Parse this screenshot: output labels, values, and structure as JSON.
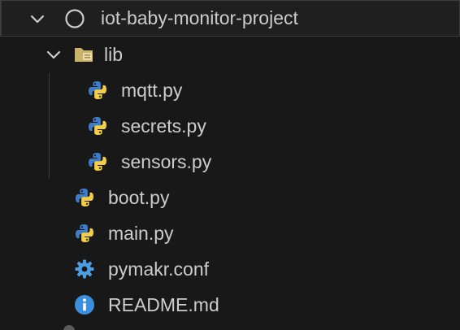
{
  "project": {
    "name": "iot-baby-monitor-project",
    "chevron_icon": "chevron-down-icon",
    "status_icon": "circle-outline-icon"
  },
  "folder": {
    "name": "lib",
    "icon": "folder-open-icon",
    "folder_color": "#c9b36b"
  },
  "files": {
    "mqtt": "mqtt.py",
    "secrets": "secrets.py",
    "sensors": "sensors.py",
    "boot": "boot.py",
    "main": "main.py",
    "pymakr": "pymakr.conf",
    "readme": "README.md"
  },
  "colors": {
    "background": "#181818",
    "text": "#cccccc",
    "python_blue": "#3f7cc7",
    "python_yellow": "#f2cd45",
    "gear_blue": "#4d9de0",
    "info_blue": "#3c8fdc"
  }
}
